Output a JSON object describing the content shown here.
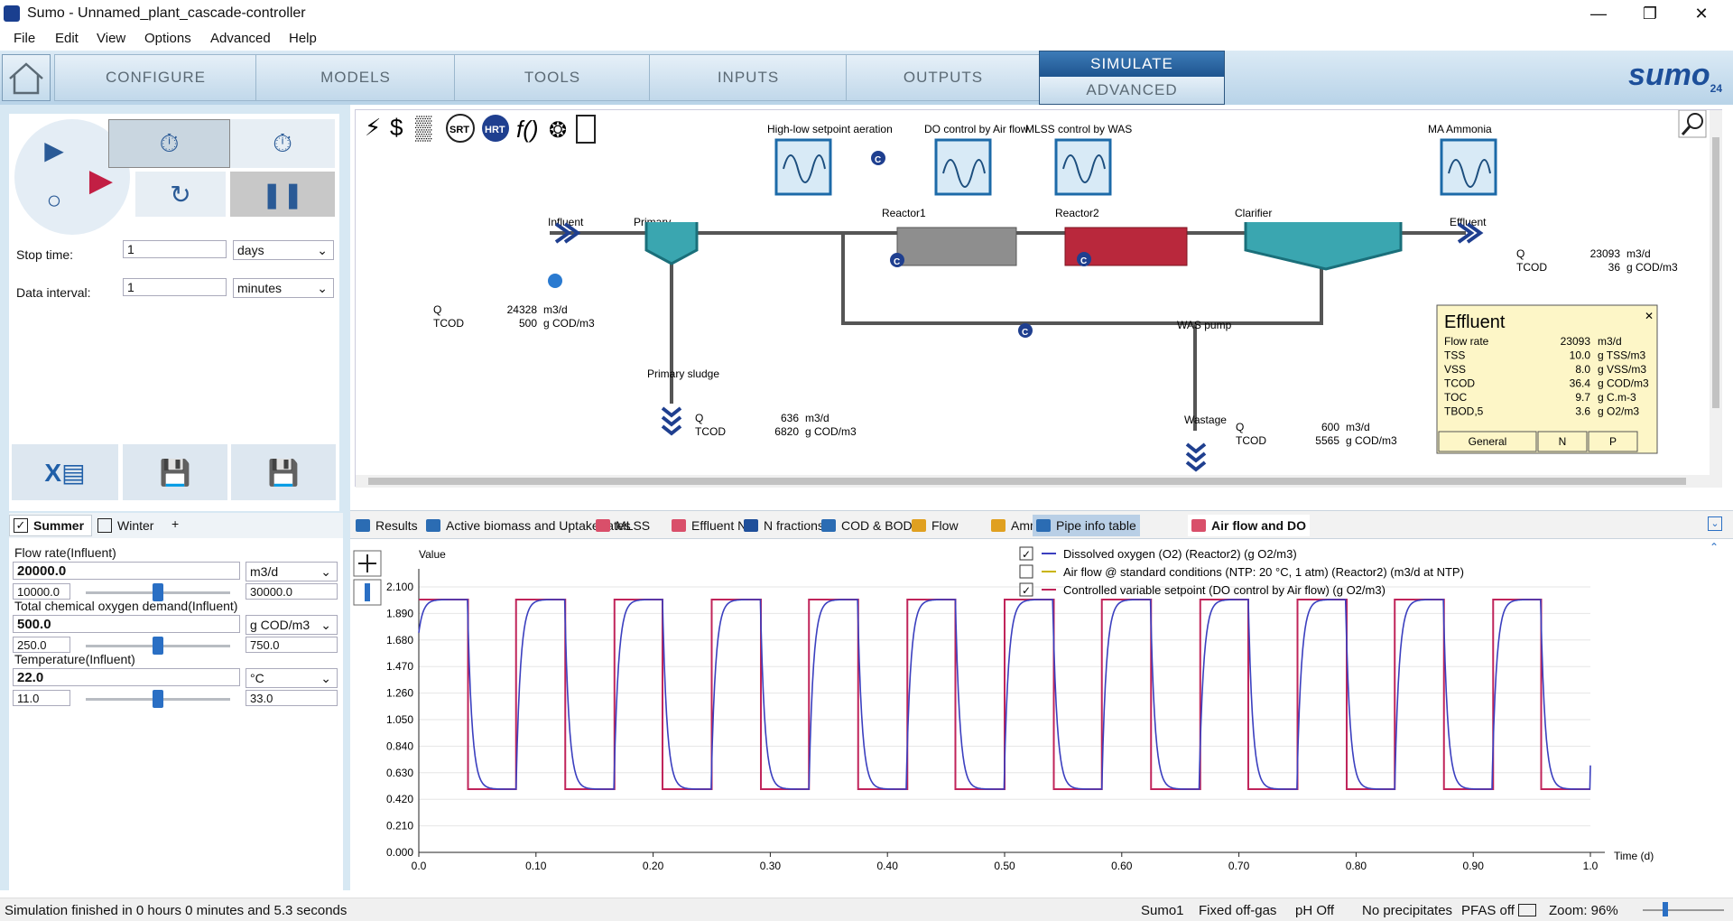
{
  "window": {
    "title": "Sumo - Unnamed_plant_cascade-controller"
  },
  "menu": [
    "File",
    "Edit",
    "View",
    "Options",
    "Advanced",
    "Help"
  ],
  "nav": {
    "tabs": [
      "CONFIGURE",
      "MODELS",
      "TOOLS",
      "INPUTS",
      "OUTPUTS"
    ],
    "simulate": "SIMULATE",
    "advanced": "ADVANCED",
    "logo": "sumo",
    "logo_badge": "24"
  },
  "sim": {
    "stop_time_label": "Stop time:",
    "stop_time_value": "1",
    "stop_time_unit": "days",
    "data_interval_label": "Data interval:",
    "data_interval_value": "1",
    "data_interval_unit": "minutes"
  },
  "scenarios": {
    "summer": "Summer",
    "winter": "Winter",
    "add": "+"
  },
  "inputs": [
    {
      "label": "Flow rate(Influent)",
      "value": "20000.0",
      "unit": "m3/d",
      "min": "10000.0",
      "max": "30000.0",
      "level": 0.5
    },
    {
      "label": "Total chemical oxygen demand(Influent)",
      "value": "500.0",
      "unit": "g COD/m3",
      "min": "250.0",
      "max": "750.0",
      "level": 0.5
    },
    {
      "label": "Temperature(Influent)",
      "value": "22.0",
      "unit": "°C",
      "min": "11.0",
      "max": "33.0",
      "level": 0.5
    }
  ],
  "diagram": {
    "controllers": [
      "High-low setpoint aeration",
      "DO control by Air flow",
      "MLSS control by WAS",
      "MA Ammonia"
    ],
    "units": {
      "influent": "Influent",
      "primary": "Primary",
      "reactor1": "Reactor1",
      "reactor2": "Reactor2",
      "clarifier": "Clarifier",
      "effluent": "Effluent",
      "primary_sludge": "Primary sludge",
      "was_pump": "WAS pump",
      "wastage": "Wastage"
    },
    "flow_labels": [
      {
        "q": "24328",
        "tcod": "500",
        "q_unit": "m3/d",
        "tcod_unit": "g COD/m3"
      },
      {
        "q": "636",
        "tcod": "6820",
        "q_unit": "m3/d",
        "tcod_unit": "g COD/m3"
      },
      {
        "q": "600",
        "tcod": "5565",
        "q_unit": "m3/d",
        "tcod_unit": "g COD/m3"
      },
      {
        "q": "23093",
        "tcod": "36",
        "q_unit": "m3/d",
        "tcod_unit": "g COD/m3"
      }
    ],
    "q_label": "Q",
    "tcod_label": "TCOD",
    "effluent_box": {
      "title": "Effluent",
      "rows": [
        {
          "name": "Flow rate",
          "value": "23093",
          "unit": "m3/d"
        },
        {
          "name": "TSS",
          "value": "10.0",
          "unit": "g TSS/m3"
        },
        {
          "name": "VSS",
          "value": "8.0",
          "unit": "g VSS/m3"
        },
        {
          "name": "TCOD",
          "value": "36.4",
          "unit": "g COD/m3"
        },
        {
          "name": "TOC",
          "value": "9.7",
          "unit": "g C.m-3"
        },
        {
          "name": "TBOD,5",
          "value": "3.6",
          "unit": "g O2/m3"
        }
      ],
      "tabs": [
        "General",
        "N",
        "P"
      ]
    },
    "toolbar_icons": [
      "SRT",
      "HRT"
    ]
  },
  "output_tabs": [
    "Results",
    "Active biomass and Uptake rates",
    "MLSS",
    "Effluent N",
    "N fractions",
    "COD & BOD5",
    "Flow",
    "Ammonia mass flow",
    "Pipe info table",
    "Air flow and DO"
  ],
  "chart_data": {
    "type": "line",
    "ylabel": "Value",
    "xlabel": "Time  (d)",
    "xlim": [
      0,
      1.0
    ],
    "ylim": [
      0,
      2.1
    ],
    "xticks": [
      "0.0",
      "0.10",
      "0.20",
      "0.30",
      "0.40",
      "0.50",
      "0.60",
      "0.70",
      "0.80",
      "0.90",
      "1.0"
    ],
    "yticks": [
      "0.000",
      "0.210",
      "0.420",
      "0.630",
      "0.840",
      "1.050",
      "1.260",
      "1.470",
      "1.680",
      "1.890",
      "2.100"
    ],
    "legend": [
      {
        "name": "Dissolved oxygen (O2) (Reactor2) (g O2/m3)",
        "color": "#3b3fbf",
        "checked": true
      },
      {
        "name": "Air flow @ standard conditions (NTP: 20 °C, 1 atm) (Reactor2) (m3/d at NTP)",
        "color": "#c9b400",
        "checked": false
      },
      {
        "name": "Controlled variable setpoint (DO control by Air flow) (g O2/m3)",
        "color": "#c0245a",
        "checked": true
      }
    ],
    "setpoint": {
      "high": 2.0,
      "low": 0.5,
      "period": 0.0833,
      "high_fraction": 0.5
    },
    "series": [
      {
        "name": "Controlled variable setpoint (DO control by Air flow) (g O2/m3)",
        "x": [
          0,
          0.042,
          0.042,
          0.083,
          0.083,
          0.125,
          0.125,
          0.167,
          0.167,
          0.208,
          0.208,
          0.25,
          0.25,
          0.292,
          0.292,
          0.333,
          0.333,
          0.375,
          0.375,
          0.417,
          0.417,
          0.458,
          0.458,
          0.5,
          0.5,
          0.542,
          0.542,
          0.583,
          0.583,
          0.625,
          0.625,
          0.667,
          0.667,
          0.708,
          0.708,
          0.75,
          0.75,
          0.792,
          0.792,
          0.833,
          0.833,
          0.875,
          0.875,
          0.917,
          0.917,
          0.958,
          0.958,
          1.0
        ],
        "y": [
          2.0,
          2.0,
          0.5,
          0.5,
          2.0,
          2.0,
          0.5,
          0.5,
          2.0,
          2.0,
          0.5,
          0.5,
          2.0,
          2.0,
          0.5,
          0.5,
          2.0,
          2.0,
          0.5,
          0.5,
          2.0,
          2.0,
          0.5,
          0.5,
          2.0,
          2.0,
          0.5,
          0.5,
          2.0,
          2.0,
          0.5,
          0.5,
          2.0,
          2.0,
          0.5,
          0.5,
          2.0,
          2.0,
          0.5,
          0.5,
          2.0,
          2.0,
          0.5,
          0.5,
          2.0,
          2.0,
          0.5,
          0.5
        ]
      }
    ]
  },
  "status": {
    "message": "Simulation finished in 0 hours 0 minutes and 5.3 seconds",
    "items": [
      "Sumo1",
      "Fixed off-gas",
      "pH Off",
      "No precipitates",
      "PFAS off"
    ],
    "zoom": "Zoom: 96%"
  }
}
